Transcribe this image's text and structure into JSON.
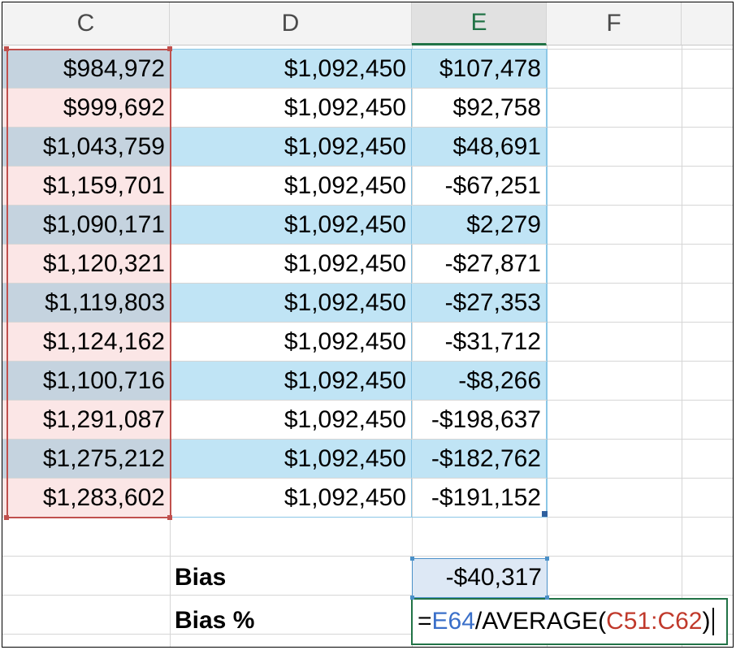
{
  "columns": [
    {
      "id": "C",
      "label": "C"
    },
    {
      "id": "D",
      "label": "D"
    },
    {
      "id": "E",
      "label": "E",
      "selected": true
    },
    {
      "id": "F",
      "label": "F"
    }
  ],
  "rows": [
    {
      "c": "$984,972",
      "d": "$1,092,450",
      "e": "$107,478"
    },
    {
      "c": "$999,692",
      "d": "$1,092,450",
      "e": "$92,758"
    },
    {
      "c": "$1,043,759",
      "d": "$1,092,450",
      "e": "$48,691"
    },
    {
      "c": "$1,159,701",
      "d": "$1,092,450",
      "e": "-$67,251"
    },
    {
      "c": "$1,090,171",
      "d": "$1,092,450",
      "e": "$2,279"
    },
    {
      "c": "$1,120,321",
      "d": "$1,092,450",
      "e": "-$27,871"
    },
    {
      "c": "$1,119,803",
      "d": "$1,092,450",
      "e": "-$27,353"
    },
    {
      "c": "$1,124,162",
      "d": "$1,092,450",
      "e": "-$31,712"
    },
    {
      "c": "$1,100,716",
      "d": "$1,092,450",
      "e": "-$8,266"
    },
    {
      "c": "$1,291,087",
      "d": "$1,092,450",
      "e": "-$198,637"
    },
    {
      "c": "$1,275,212",
      "d": "$1,092,450",
      "e": "-$182,762"
    },
    {
      "c": "$1,283,602",
      "d": "$1,092,450",
      "e": "-$191,152"
    }
  ],
  "summary": {
    "bias_label": "Bias",
    "bias_value": "-$40,317",
    "bias_pct_label": "Bias %"
  },
  "formula": {
    "prefix": "=",
    "ref1": "E64",
    "middle": "/AVERAGE(",
    "ref2": "C51:C62",
    "suffix": ")"
  },
  "colors": {
    "header_selected": "#217346",
    "table_band": "#c0e4f5",
    "ref_blue": "#3a6fc9",
    "ref_red": "#c0392b"
  }
}
